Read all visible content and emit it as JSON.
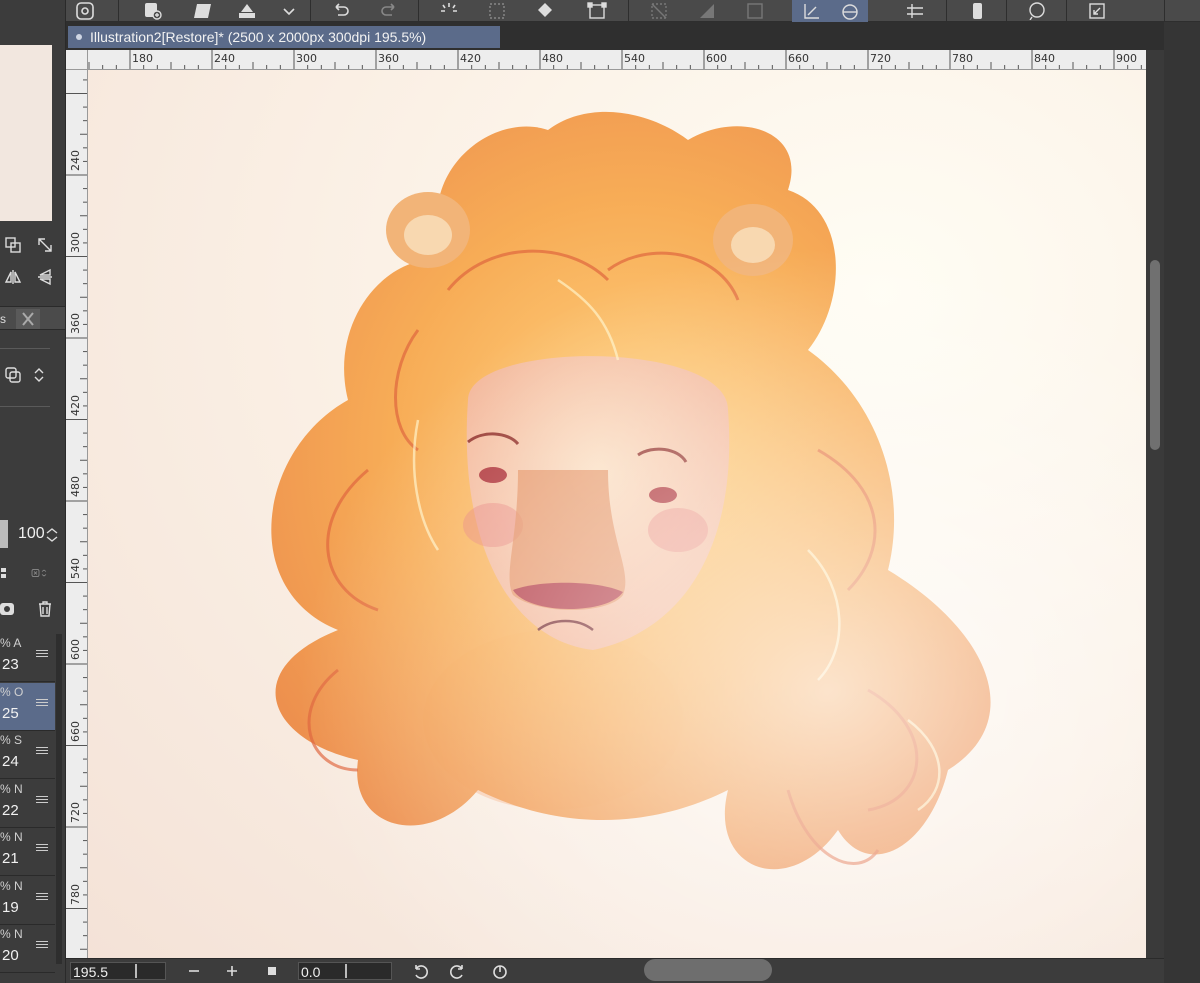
{
  "document": {
    "tab_title": "Illustration2[Restore]* (2500 x 2000px 300dpi 195.5%)"
  },
  "ruler": {
    "x_labels": [
      "180",
      "240",
      "300",
      "360",
      "420",
      "480",
      "540",
      "600",
      "660",
      "720",
      "780",
      "840",
      "900"
    ],
    "y_labels": [
      "240",
      "300",
      "360",
      "420",
      "480",
      "540",
      "600",
      "660",
      "720",
      "780"
    ]
  },
  "layer_panel": {
    "tab_label": "s",
    "opacity": "100",
    "layers": [
      {
        "mode": "% A",
        "opacity": "23",
        "selected": false
      },
      {
        "mode": "% O",
        "opacity": "25",
        "selected": true
      },
      {
        "mode": "% S",
        "opacity": "24",
        "selected": false
      },
      {
        "mode": "% N",
        "opacity": "22",
        "selected": false
      },
      {
        "mode": "% N",
        "opacity": "21",
        "selected": false
      },
      {
        "mode": "% N",
        "opacity": "19",
        "selected": false
      },
      {
        "mode": "% N",
        "opacity": "20",
        "selected": false
      }
    ]
  },
  "bottom_bar": {
    "zoom": "195.5",
    "rotation": "0.0"
  },
  "colors": {
    "accent": "#5b6b8a",
    "panel": "#3c3c3c"
  }
}
